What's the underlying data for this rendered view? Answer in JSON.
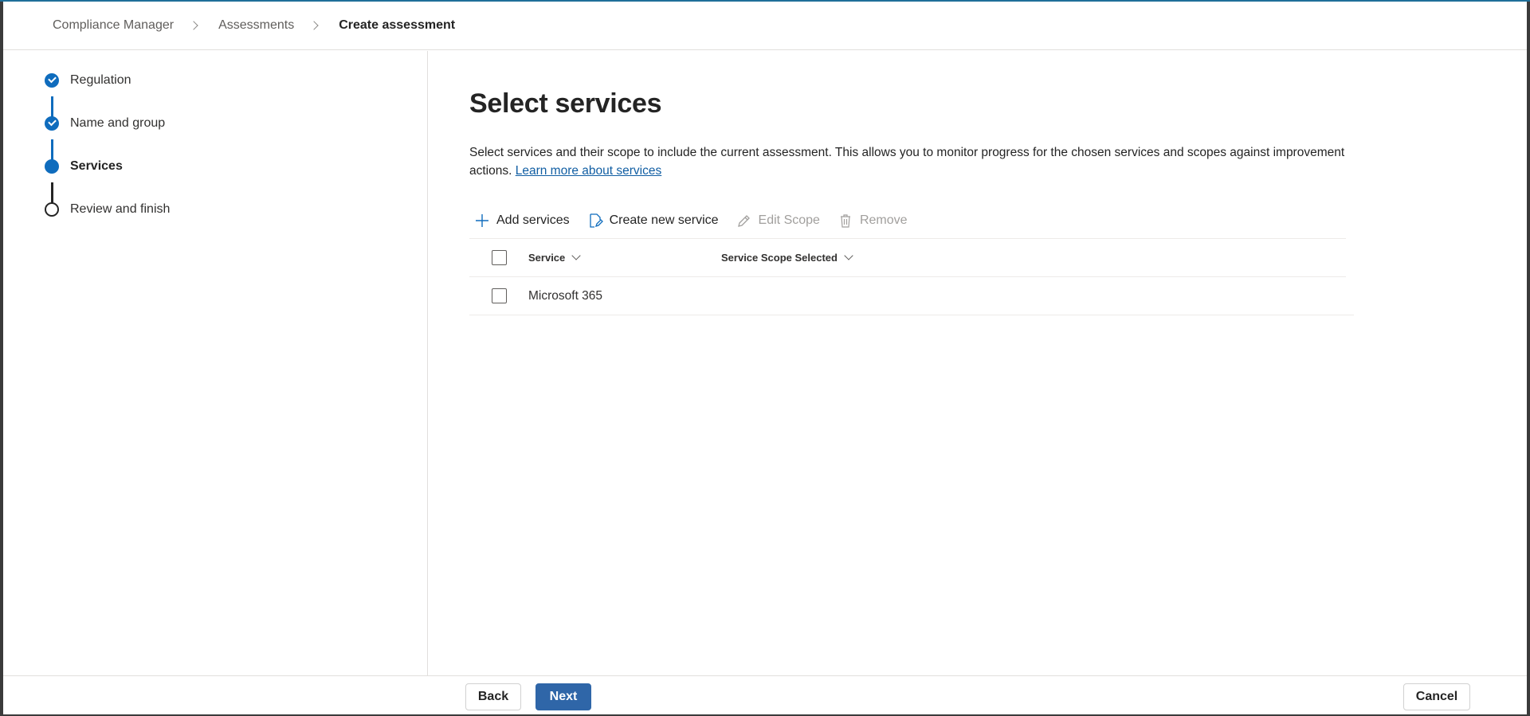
{
  "breadcrumb": {
    "items": [
      "Compliance Manager",
      "Assessments",
      "Create assessment"
    ]
  },
  "steps": [
    {
      "label": "Regulation",
      "state": "done"
    },
    {
      "label": "Name and group",
      "state": "done"
    },
    {
      "label": "Services",
      "state": "current"
    },
    {
      "label": "Review and finish",
      "state": "todo"
    }
  ],
  "main": {
    "title": "Select services",
    "description": "Select services and their scope to include the current assessment. This allows you to monitor progress for the chosen services and scopes against improvement actions. ",
    "learn_more": "Learn more about services"
  },
  "toolbar": {
    "add_services": "Add services",
    "create_new_service": "Create new service",
    "edit_scope": "Edit Scope",
    "remove": "Remove"
  },
  "grid": {
    "columns": [
      "Service",
      "Service Scope Selected"
    ],
    "rows": [
      {
        "service": "Microsoft 365",
        "scope": ""
      }
    ]
  },
  "footer": {
    "back": "Back",
    "next": "Next",
    "cancel": "Cancel"
  },
  "colors": {
    "accent": "#0f6cbd",
    "primary_button": "#2f66a8",
    "link": "#115ea3"
  },
  "icons": {
    "add": "plus-icon",
    "create": "edit-document-icon",
    "edit_scope": "pencil-icon",
    "remove": "trash-icon"
  }
}
